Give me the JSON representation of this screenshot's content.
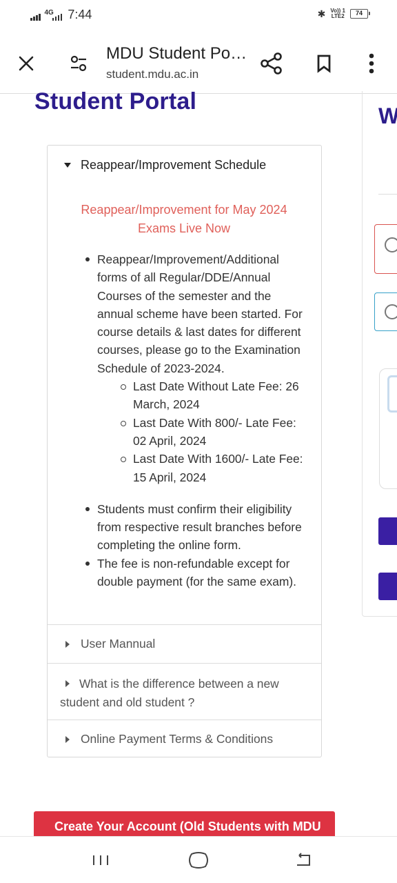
{
  "status_bar": {
    "network": "4G",
    "time": "7:44",
    "volte": [
      "Vo)) 1",
      "LTE2"
    ],
    "battery": "74"
  },
  "toolbar": {
    "title": "MDU Student Portal",
    "url": "student.mdu.ac.in"
  },
  "page": {
    "title": "Student Portal",
    "side_heading_peek": "W"
  },
  "accordion": {
    "open_item": {
      "label": "Reappear/Improvement Schedule",
      "notice": "Reappear/Improvement for May 2024 Exams Live Now",
      "bullets": [
        {
          "text": "Reappear/Improvement/Additional forms of all Regular/DDE/Annual Courses of the semester and the annual scheme have been started. For course details & last dates for different courses, please go to the Examination Schedule of 2023-2024.",
          "sub": [
            "Last Date Without Late Fee: 26 March, 2024",
            "Last Date With 800/- Late Fee: 02 April, 2024",
            "Last Date With 1600/- Late Fee: 15 April, 2024"
          ]
        },
        {
          "text": "Students must confirm their eligibility from respective result branches before completing the online form."
        },
        {
          "text": "The fee is non-refundable except for double payment (for the same exam)."
        }
      ]
    },
    "collapsed_items": [
      "User Mannual",
      "What is the difference between a new student and old student ?",
      "Online Payment Terms & Conditions"
    ]
  },
  "create_account": {
    "label": "Create Your Account (Old Students with MDU"
  },
  "colors": {
    "title": "#2d1d8c",
    "notice": "#e0605a",
    "create_button": "#dd3342",
    "side_button": "#3a1fa3"
  },
  "icons": {
    "toolbar": [
      "close-icon",
      "tune-icon",
      "share-icon",
      "bookmark-icon",
      "more-vert-icon"
    ],
    "nav": [
      "recent-apps-icon",
      "home-icon",
      "back-icon"
    ]
  }
}
